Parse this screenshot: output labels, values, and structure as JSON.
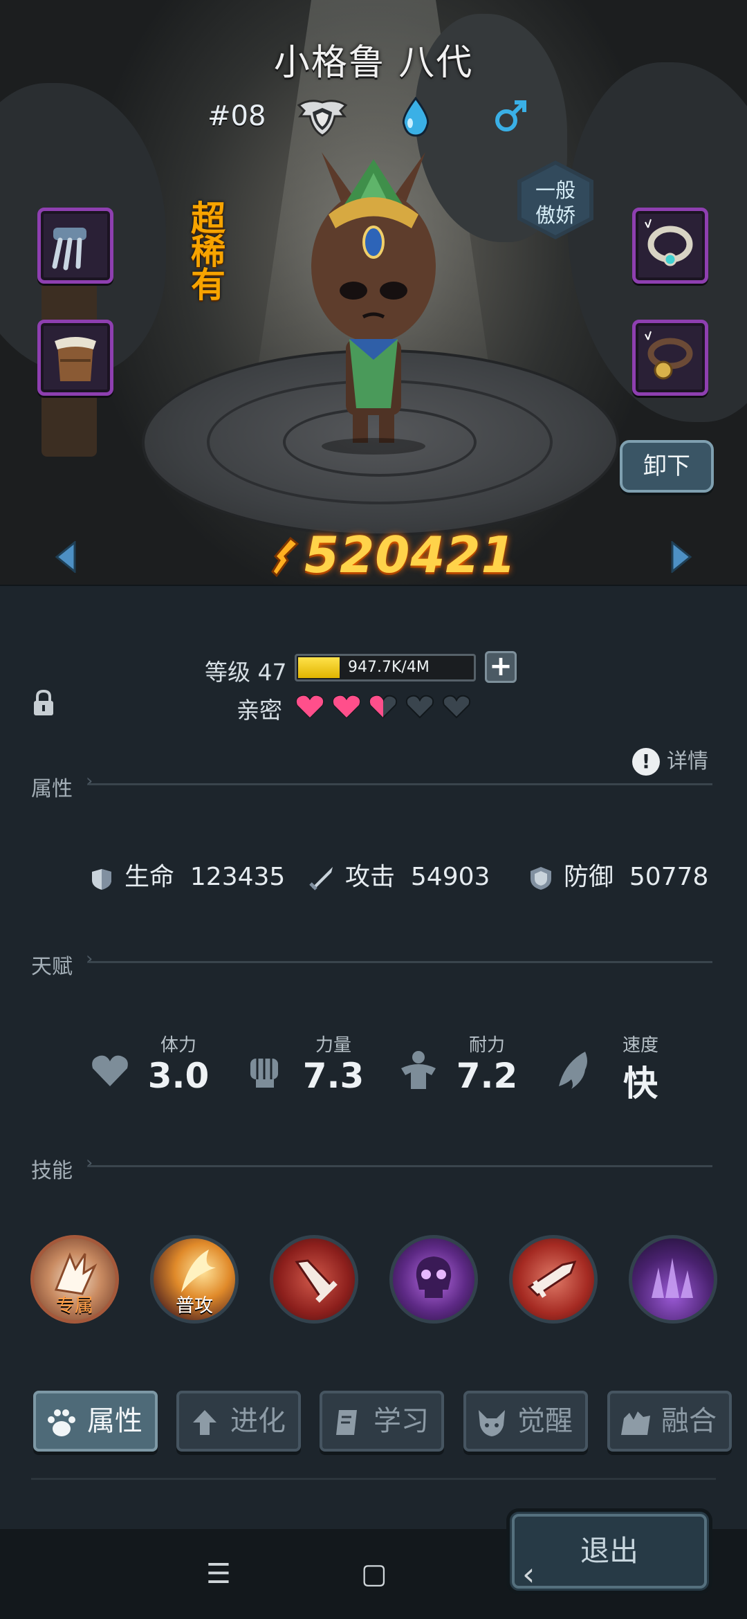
{
  "character": {
    "name": "小格鲁 八代",
    "number": "#08",
    "rarity": "超\n稀\n有",
    "personality_line1": "一般",
    "personality_line2": "傲娇",
    "unequip_label": "卸下",
    "power": "520421"
  },
  "equipment_slots": [
    {
      "name": "claw-weapon-icon"
    },
    {
      "name": "fur-armor-icon"
    },
    {
      "name": "jeweled-necklace-icon"
    },
    {
      "name": "bell-collar-icon"
    }
  ],
  "level": {
    "label": "等级 47",
    "xp_text": "947.7K/4M",
    "xp_fraction": 0.237,
    "intimacy_label": "亲密",
    "hearts_filled": 2.5,
    "hearts_total": 5
  },
  "sections": {
    "attributes": "属性",
    "talents": "天赋",
    "skills": "技能",
    "details": "详情"
  },
  "stats": [
    {
      "label": "生命",
      "value": "123435",
      "icon": "hp-heart-icon"
    },
    {
      "label": "攻击",
      "value": "54903",
      "icon": "attack-sword-icon"
    },
    {
      "label": "防御",
      "value": "50778",
      "icon": "defense-shield-icon"
    }
  ],
  "talents": [
    {
      "label": "体力",
      "value": "3.0",
      "icon": "stamina-heart-icon"
    },
    {
      "label": "力量",
      "value": "7.3",
      "icon": "strength-fist-icon"
    },
    {
      "label": "耐力",
      "value": "7.2",
      "icon": "endurance-body-icon"
    },
    {
      "label": "速度",
      "value": "快",
      "icon": "speed-wing-icon"
    }
  ],
  "skills": [
    {
      "label": "专属",
      "icon": "exclusive-claw-skill-icon"
    },
    {
      "label": "普攻",
      "icon": "basic-attack-skill-icon"
    },
    {
      "label": "",
      "icon": "sword-slash-skill-icon"
    },
    {
      "label": "",
      "icon": "skull-flame-skill-icon"
    },
    {
      "label": "",
      "icon": "sword-strike-skill-icon"
    },
    {
      "label": "",
      "icon": "purple-crystal-skill-icon"
    }
  ],
  "tabs": [
    {
      "label": "属性",
      "active": true
    },
    {
      "label": "进化",
      "active": false
    },
    {
      "label": "学习",
      "active": false
    },
    {
      "label": "觉醒",
      "active": false
    },
    {
      "label": "融合",
      "active": false
    }
  ],
  "exit_label": "退出",
  "colors": {
    "rarity": "#f7a400",
    "power": "#ffd34a",
    "heart": "#ff4f8b",
    "slot_border": "#8e3fb0"
  }
}
